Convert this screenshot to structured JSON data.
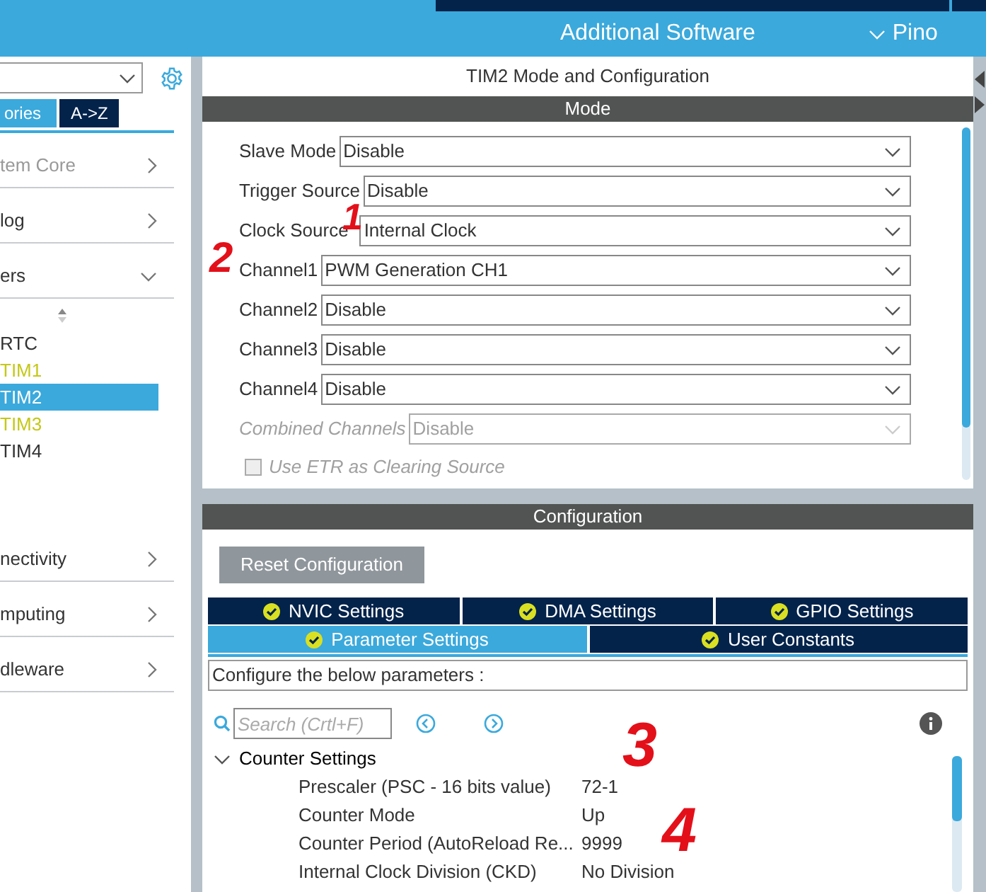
{
  "header": {
    "additional_software": "Additional Software",
    "pinout": "Pino"
  },
  "sidebar": {
    "sort_tabs": [
      {
        "label": "ories",
        "selected": true
      },
      {
        "label": "A->Z",
        "selected": false
      }
    ],
    "categories": [
      {
        "label": "tem Core",
        "disabled": true,
        "expanded": false
      },
      {
        "label": "log",
        "disabled": false,
        "expanded": false
      },
      {
        "label": "ers",
        "disabled": false,
        "expanded": true,
        "children": [
          {
            "label": "RTC",
            "color": "#333333",
            "selected": false
          },
          {
            "label": "TIM1",
            "color": "#c4c81a",
            "selected": false
          },
          {
            "label": "TIM2",
            "selected": true
          },
          {
            "label": "TIM3",
            "color": "#c4c81a",
            "selected": false
          },
          {
            "label": "TIM4",
            "color": "#333333",
            "selected": false
          }
        ]
      },
      {
        "label": "nectivity",
        "disabled": false,
        "expanded": false
      },
      {
        "label": "mputing",
        "disabled": false,
        "expanded": false
      },
      {
        "label": "dleware",
        "disabled": false,
        "expanded": false
      }
    ]
  },
  "panel": {
    "title": "TIM2 Mode and Configuration",
    "mode": {
      "header": "Mode",
      "fields": [
        {
          "label": "Slave Mode",
          "value": "Disable",
          "disabled": false
        },
        {
          "label": "Trigger Source",
          "value": "Disable",
          "disabled": false
        },
        {
          "label": "Clock Source",
          "value": "Internal Clock",
          "disabled": false
        },
        {
          "label": "Channel1",
          "value": "PWM Generation CH1",
          "disabled": false
        },
        {
          "label": "Channel2",
          "value": "Disable",
          "disabled": false
        },
        {
          "label": "Channel3",
          "value": "Disable",
          "disabled": false
        },
        {
          "label": "Channel4",
          "value": "Disable",
          "disabled": false
        },
        {
          "label": "Combined Channels",
          "value": "Disable",
          "disabled": true
        }
      ],
      "checkbox": {
        "label": "Use ETR as Clearing Source",
        "checked": false,
        "disabled": true
      }
    },
    "configuration": {
      "header": "Configuration",
      "reset_button": "Reset Configuration",
      "tab_rows": [
        [
          {
            "label": "NVIC Settings",
            "selected": false
          },
          {
            "label": "DMA Settings",
            "selected": false
          },
          {
            "label": "GPIO Settings",
            "selected": false
          }
        ],
        [
          {
            "label": "Parameter Settings",
            "selected": true
          },
          {
            "label": "User Constants",
            "selected": false
          }
        ]
      ],
      "description": "Configure the below parameters :",
      "search": {
        "placeholder": "Search (Crtl+F)"
      },
      "groups": [
        {
          "label": "Counter Settings",
          "expanded": true,
          "params": [
            {
              "name": "Prescaler (PSC - 16 bits value)",
              "value": "72-1"
            },
            {
              "name": "Counter Mode",
              "value": "Up"
            },
            {
              "name": "Counter Period (AutoReload Re...",
              "value": "9999"
            },
            {
              "name": "Internal Clock Division (CKD)",
              "value": "No Division"
            }
          ]
        }
      ]
    }
  },
  "annotations": [
    {
      "label": "1"
    },
    {
      "label": "2"
    },
    {
      "label": "3"
    },
    {
      "label": "4"
    }
  ]
}
